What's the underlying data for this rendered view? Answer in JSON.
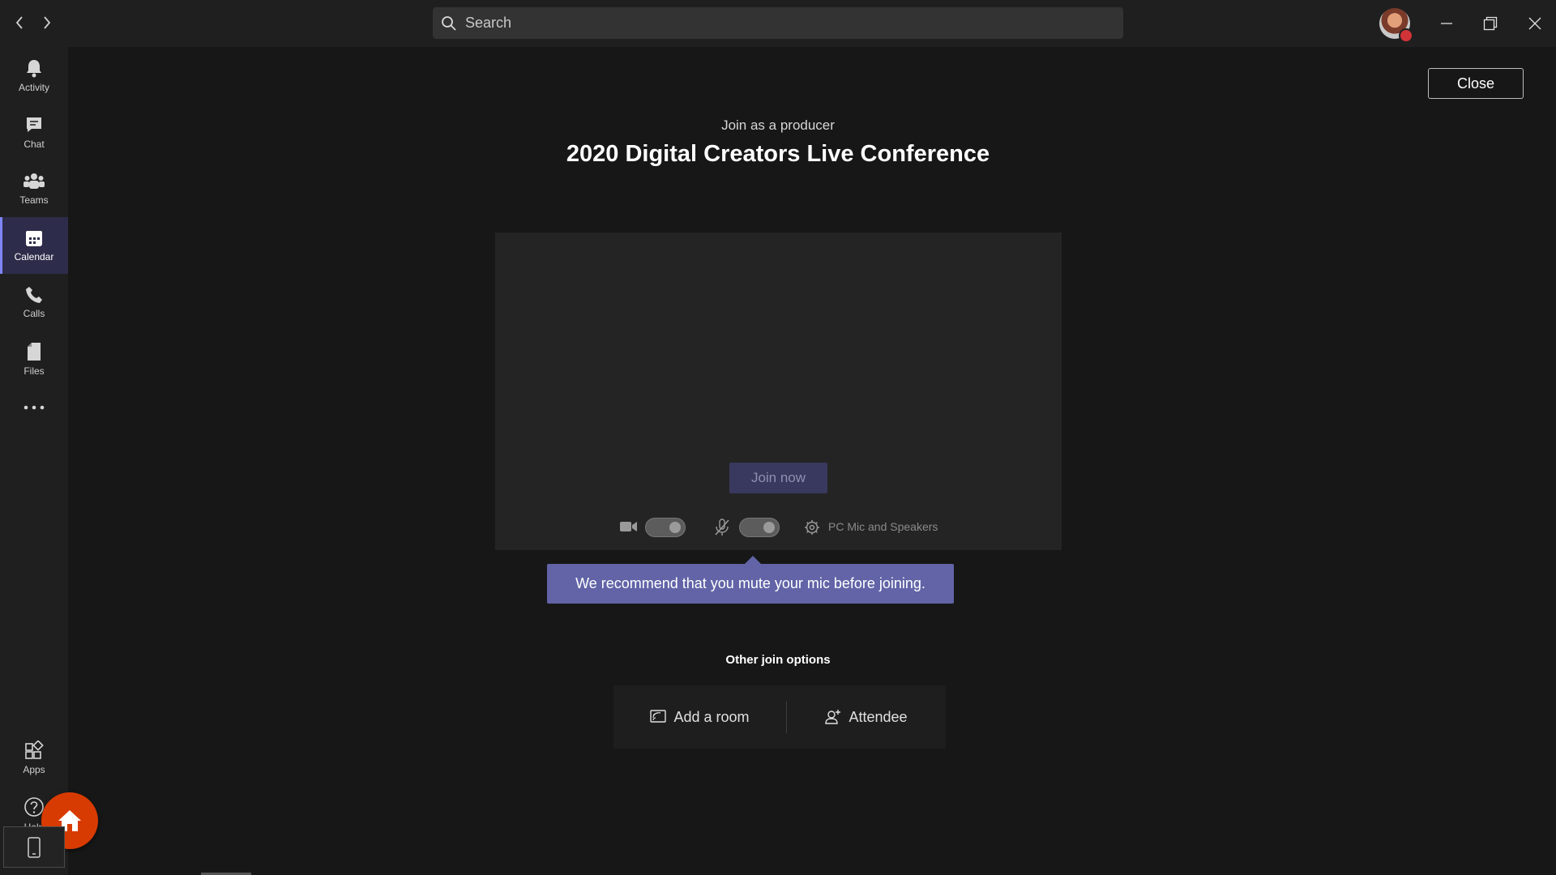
{
  "titlebar": {
    "back_icon": "chevron-left-icon",
    "forward_icon": "chevron-right-icon",
    "search_placeholder": "Search",
    "window_controls": [
      "minimize-icon",
      "restore-icon",
      "close-icon"
    ]
  },
  "rail": {
    "items": [
      {
        "label": "Activity",
        "icon": "bell-icon"
      },
      {
        "label": "Chat",
        "icon": "chat-icon"
      },
      {
        "label": "Teams",
        "icon": "teams-icon"
      },
      {
        "label": "Calendar",
        "icon": "calendar-icon",
        "active": true
      },
      {
        "label": "Calls",
        "icon": "phone-icon"
      },
      {
        "label": "Files",
        "icon": "file-icon"
      }
    ],
    "more_icon": "more-icon",
    "bottom_items": [
      {
        "label": "Apps",
        "icon": "apps-icon"
      },
      {
        "label": "Help",
        "icon": "help-icon"
      }
    ]
  },
  "main": {
    "close_label": "Close",
    "subheading": "Join as a producer",
    "heading": "2020 Digital Creators Live Conference",
    "join_label": "Join now",
    "device_label": "PC Mic and Speakers",
    "tooltip": "We recommend that you mute your mic before joining.",
    "other_options_label": "Other join options",
    "options": [
      {
        "label": "Add a room",
        "icon": "cast-icon"
      },
      {
        "label": "Attendee",
        "icon": "person-add-icon"
      }
    ]
  },
  "colors": {
    "accent": "#6264a7",
    "home_fab": "#d83b01",
    "presence_busy": "#d13438"
  }
}
